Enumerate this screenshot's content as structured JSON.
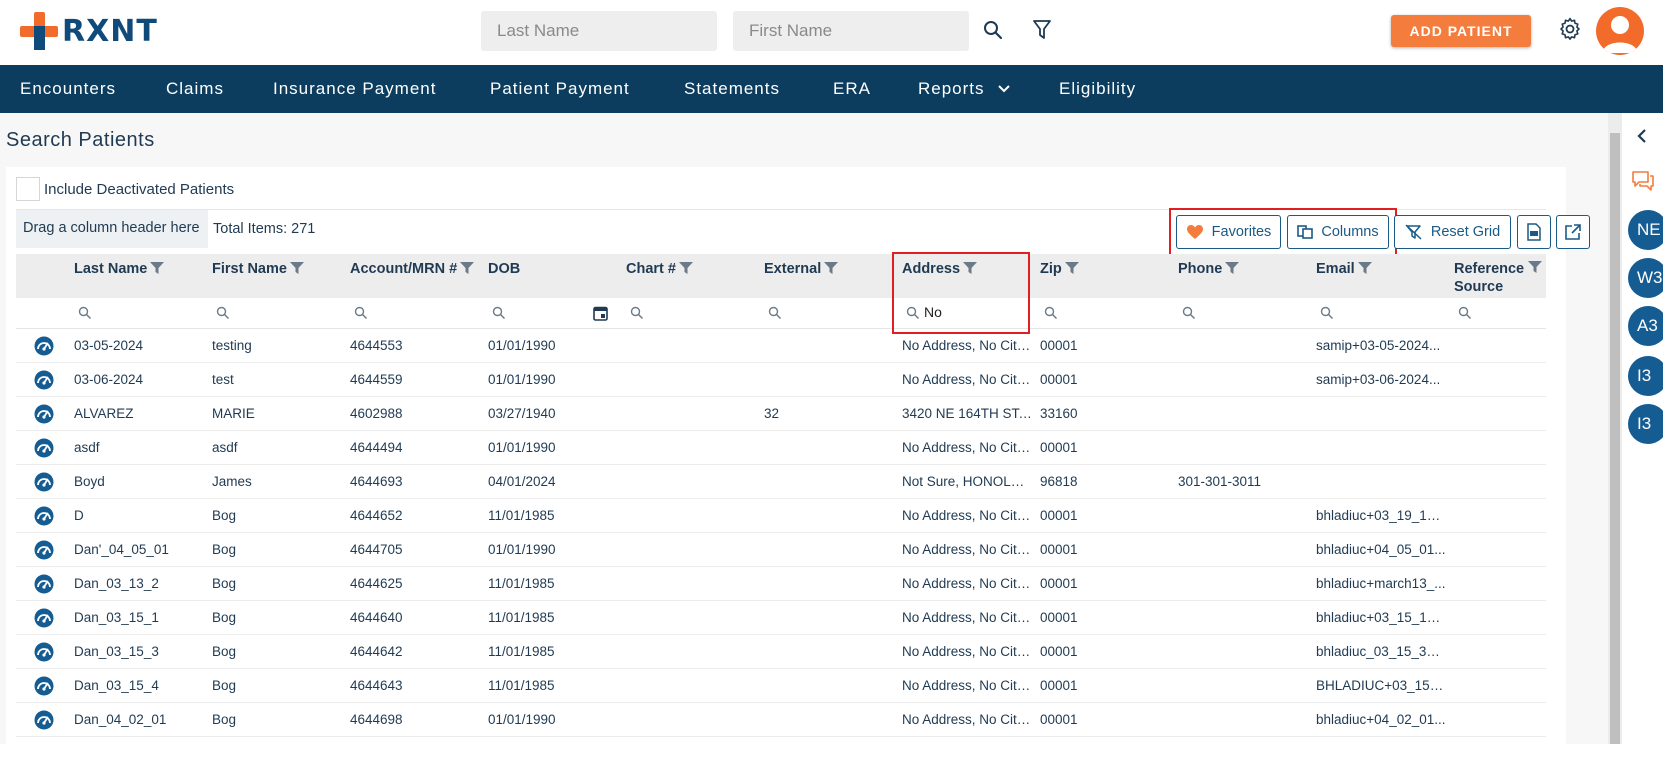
{
  "brand": {
    "name": "RXNT"
  },
  "header": {
    "last_name_placeholder": "Last Name",
    "first_name_placeholder": "First Name",
    "add_patient_label": "ADD PATIENT"
  },
  "nav": {
    "items": [
      "Encounters",
      "Claims",
      "Insurance Payment",
      "Patient Payment",
      "Statements",
      "ERA",
      "Reports",
      "Eligibility"
    ]
  },
  "page": {
    "title": "Search Patients",
    "include_deactivated_label": "Include Deactivated Patients",
    "group_drop_label": "Drag a column header here",
    "total_items": "Total Items: 271"
  },
  "toolbar": {
    "favorites_label": "Favorites",
    "columns_label": "Columns",
    "reset_grid_label": "Reset Grid"
  },
  "grid": {
    "columns": [
      "Last Name",
      "First Name",
      "Account/MRN #",
      "DOB",
      "Chart #",
      "External",
      "Address",
      "Zip",
      "Phone",
      "Email",
      "Reference Source"
    ],
    "address_filter_value": "No",
    "rows": [
      {
        "last": "03-05-2024",
        "first": "testing",
        "mrn": "4644553",
        "dob": "01/01/1990",
        "chart": "",
        "external": "",
        "address": "No Address, No City,...",
        "zip": "00001",
        "phone": "",
        "email": "samip+03-05-2024...",
        "ref": ""
      },
      {
        "last": "03-06-2024",
        "first": "test",
        "mrn": "4644559",
        "dob": "01/01/1990",
        "chart": "",
        "external": "",
        "address": "No Address, No City,...",
        "zip": "00001",
        "phone": "",
        "email": "samip+03-06-2024...",
        "ref": ""
      },
      {
        "last": "ALVAREZ",
        "first": "MARIE",
        "mrn": "4602988",
        "dob": "03/27/1940",
        "chart": "",
        "external": "32",
        "address": "3420 NE 164TH ST, ...",
        "zip": "33160",
        "phone": "",
        "email": "",
        "ref": ""
      },
      {
        "last": "asdf",
        "first": "asdf",
        "mrn": "4644494",
        "dob": "01/01/1990",
        "chart": "",
        "external": "",
        "address": "No Address, No City,...",
        "zip": "00001",
        "phone": "",
        "email": "",
        "ref": ""
      },
      {
        "last": "Boyd",
        "first": "James",
        "mrn": "4644693",
        "dob": "04/01/2024",
        "chart": "",
        "external": "",
        "address": "Not Sure, HONOLUL...",
        "zip": "96818",
        "phone": "301-301-3011",
        "email": "",
        "ref": ""
      },
      {
        "last": "D",
        "first": "Bog",
        "mrn": "4644652",
        "dob": "11/01/1985",
        "chart": "",
        "external": "",
        "address": "No Address, No City,...",
        "zip": "00001",
        "phone": "",
        "email": "bhladiuc+03_19_1@...",
        "ref": ""
      },
      {
        "last": "Dan'_04_05_01",
        "first": "Bog",
        "mrn": "4644705",
        "dob": "01/01/1990",
        "chart": "",
        "external": "",
        "address": "No Address, No City,...",
        "zip": "00001",
        "phone": "",
        "email": "bhladiuc+04_05_01...",
        "ref": ""
      },
      {
        "last": "Dan_03_13_2",
        "first": "Bog",
        "mrn": "4644625",
        "dob": "11/01/1985",
        "chart": "",
        "external": "",
        "address": "No Address, No City,...",
        "zip": "00001",
        "phone": "",
        "email": "bhladiuc+march13_...",
        "ref": ""
      },
      {
        "last": "Dan_03_15_1",
        "first": "Bog",
        "mrn": "4644640",
        "dob": "11/01/1985",
        "chart": "",
        "external": "",
        "address": "No Address, No City,...",
        "zip": "00001",
        "phone": "",
        "email": "bhladiuc+03_15_1@...",
        "ref": ""
      },
      {
        "last": "Dan_03_15_3",
        "first": "Bog",
        "mrn": "4644642",
        "dob": "11/01/1985",
        "chart": "",
        "external": "",
        "address": "No Address, No City,...",
        "zip": "00001",
        "phone": "",
        "email": "bhladiuc_03_15_3@...",
        "ref": ""
      },
      {
        "last": "Dan_03_15_4",
        "first": "Bog",
        "mrn": "4644643",
        "dob": "11/01/1985",
        "chart": "",
        "external": "",
        "address": "No Address, No City,...",
        "zip": "00001",
        "phone": "",
        "email": "BHLADIUC+03_15_...",
        "ref": ""
      },
      {
        "last": "Dan_04_02_01",
        "first": "Bog",
        "mrn": "4644698",
        "dob": "01/01/1990",
        "chart": "",
        "external": "",
        "address": "No Address, No City,...",
        "zip": "00001",
        "phone": "",
        "email": "bhladiuc+04_02_01...",
        "ref": ""
      }
    ]
  },
  "right_panel": {
    "badges": [
      "NE",
      "W3",
      "A3",
      "I3",
      "I3"
    ]
  },
  "colors": {
    "accent": "#f47c3c",
    "nav_bg": "#0c3d5e",
    "brand_blue": "#0f4a7a",
    "badge_blue": "#155c93"
  }
}
